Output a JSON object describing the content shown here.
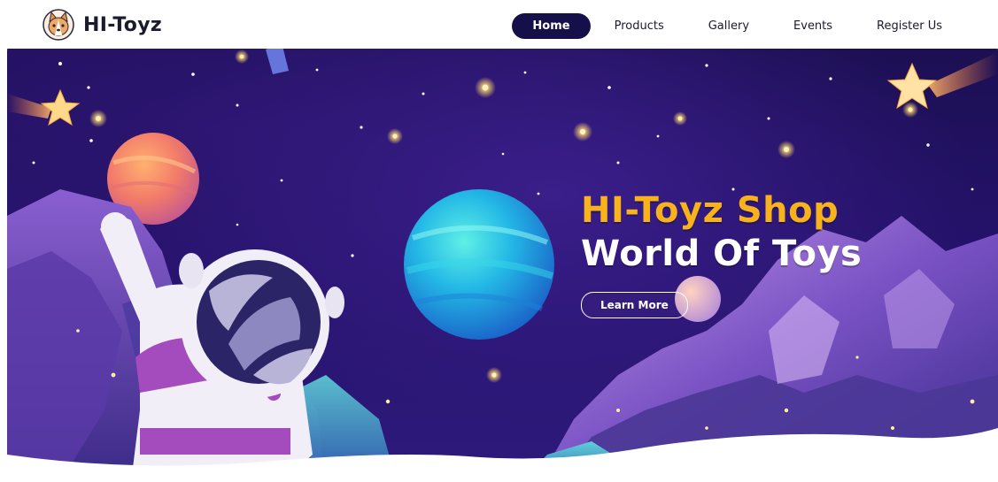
{
  "brand": {
    "name": "HI-Toyz",
    "logo_icon": "corgi-logo-icon"
  },
  "nav": {
    "items": [
      {
        "label": "Home",
        "active": true
      },
      {
        "label": "Products",
        "active": false
      },
      {
        "label": "Gallery",
        "active": false
      },
      {
        "label": "Events",
        "active": false
      },
      {
        "label": "Register Us",
        "active": false
      }
    ]
  },
  "hero": {
    "title": "HI-Toyz Shop",
    "subtitle": "World Of Toys",
    "cta_label": "Learn More"
  },
  "colors": {
    "nav_active_bg": "#15104a",
    "title_accent": "#f7b21c",
    "hero_bg": "#24126a"
  }
}
